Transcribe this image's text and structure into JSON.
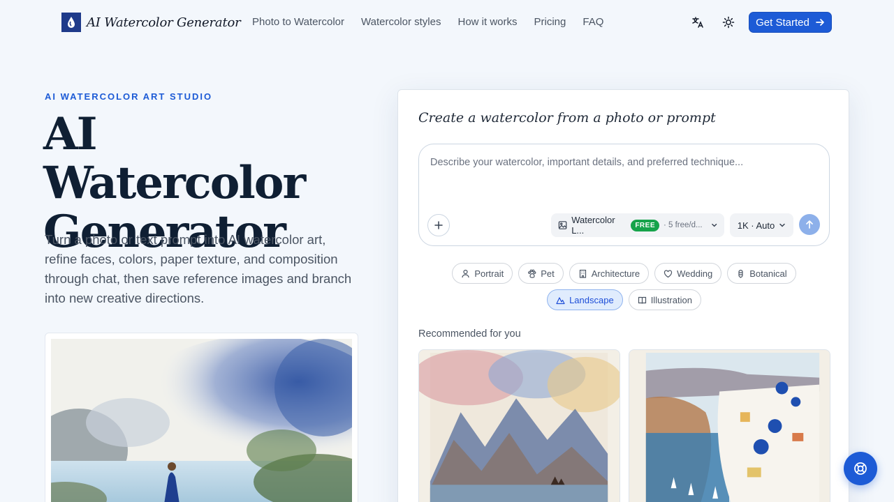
{
  "header": {
    "brand": "AI Watercolor Generator",
    "nav": [
      "Photo to Watercolor",
      "Watercolor styles",
      "How it works",
      "Pricing",
      "FAQ"
    ],
    "cta_label": "Get Started"
  },
  "hero": {
    "eyebrow": "AI WATERCOLOR ART STUDIO",
    "title_line1": "AI Watercolor",
    "title_line2": "Generator",
    "subtitle": "Turn a photo or text prompt into AI watercolor art, refine faces, colors, paper texture, and composition through chat, then save reference images and branch into new creative directions."
  },
  "generator": {
    "title": "Create a watercolor from a photo or prompt",
    "prompt_placeholder": "Describe your watercolor, important details, and preferred technique...",
    "model_label": "Watercolor L...",
    "free_badge": "FREE",
    "quota": "· 5 free/d...",
    "size_label": "1K · Auto",
    "chips_row1": [
      "Portrait",
      "Pet",
      "Architecture",
      "Wedding",
      "Botanical"
    ],
    "chips_row2": [
      "Landscape",
      "Illustration"
    ],
    "active_chip": "Landscape",
    "recommended_label": "Recommended for you"
  },
  "colors": {
    "accent": "#1d5bd6",
    "free_badge": "#16a34a",
    "active_chip_bg": "#e0ecfd"
  },
  "icons": {
    "translate": "translate-icon",
    "theme": "sun-icon",
    "cta": "arrow-right-icon",
    "add": "plus-icon",
    "model": "image-icon",
    "send": "arrow-up-icon",
    "help": "lifebuoy-icon"
  }
}
